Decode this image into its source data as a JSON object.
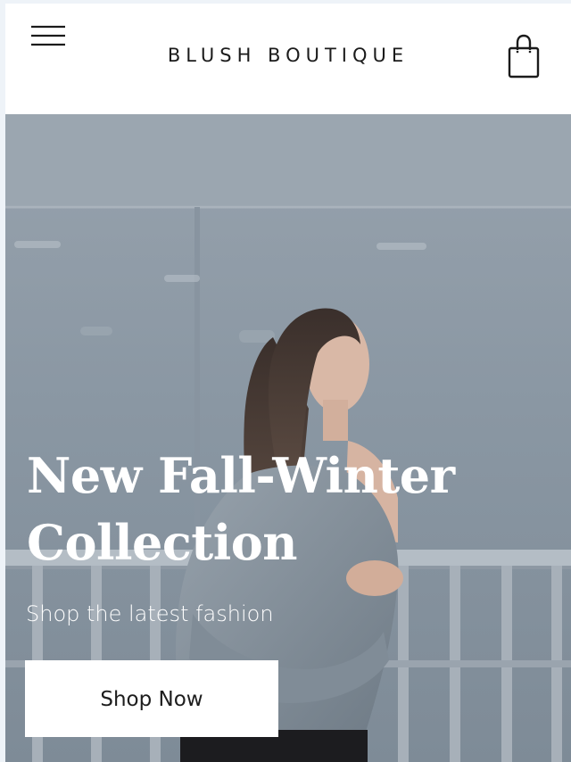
{
  "header": {
    "brand": "BLUSH BOUTIQUE",
    "menu_icon": "hamburger-menu-icon",
    "cart_icon": "shopping-bag-icon"
  },
  "hero": {
    "title": "New Fall-Winter Collection",
    "subtitle": "Shop the latest fashion",
    "cta_label": "Shop Now"
  },
  "colors": {
    "header_bg": "#ffffff",
    "text_dark": "#1b1b1b",
    "hero_text": "#ffffff",
    "button_bg": "#ffffff"
  }
}
